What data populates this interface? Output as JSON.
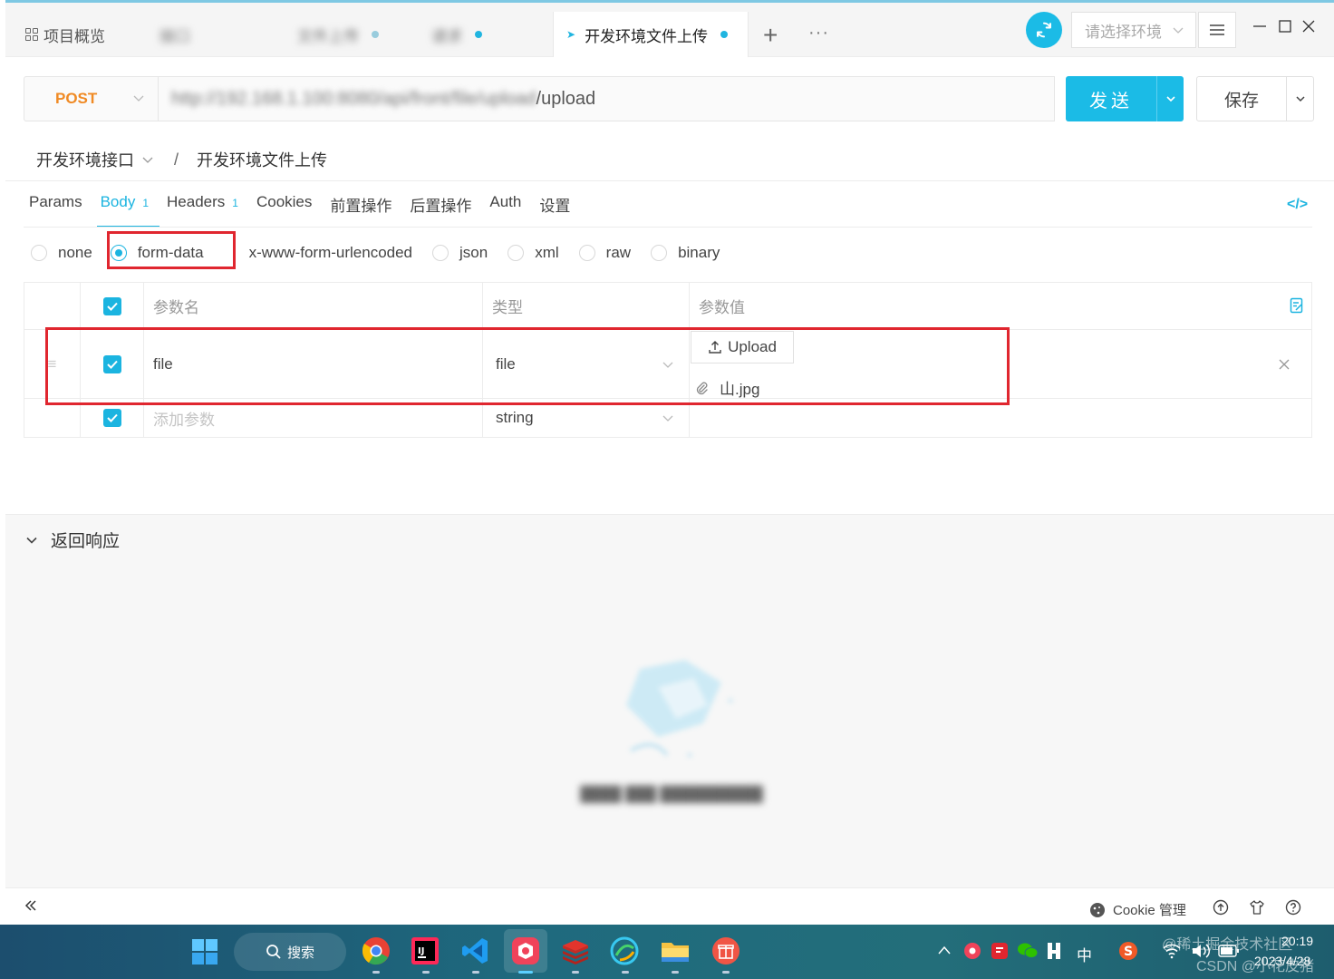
{
  "tabs": {
    "overview": "项目概览",
    "active_tab": "开发环境文件上传",
    "blurred": [
      "接口",
      "文件上传",
      "请求"
    ]
  },
  "toolbar": {
    "env_placeholder": "请选择环境",
    "new_tab": "+",
    "more": "···"
  },
  "request": {
    "method": "POST",
    "url_visible_suffix": "/upload",
    "url_blurred_prefix": "http://192.168.1.100:8080/api/front/file/upload",
    "send_label": "发送",
    "save_label": "保存"
  },
  "breadcrumb": {
    "folder": "开发环境接口",
    "separator": "/",
    "name": "开发环境文件上传"
  },
  "request_tabs": [
    {
      "label": "Params",
      "count": ""
    },
    {
      "label": "Body",
      "count": "1"
    },
    {
      "label": "Headers",
      "count": "1"
    },
    {
      "label": "Cookies",
      "count": ""
    },
    {
      "label": "前置操作",
      "count": ""
    },
    {
      "label": "后置操作",
      "count": ""
    },
    {
      "label": "Auth",
      "count": ""
    },
    {
      "label": "设置",
      "count": ""
    }
  ],
  "body_types": [
    "none",
    "form-data",
    "x-www-form-urlencoded",
    "json",
    "xml",
    "raw",
    "binary"
  ],
  "body_selected": "form-data",
  "table": {
    "headers": {
      "name": "参数名",
      "type": "类型",
      "value": "参数值"
    },
    "rows": [
      {
        "name": "file",
        "type": "file",
        "upload_label": "Upload",
        "filename": "山.jpg"
      }
    ],
    "new_row": {
      "name_placeholder": "添加参数",
      "type": "string"
    }
  },
  "response": {
    "title": "返回响应"
  },
  "statusbar": {
    "cookie": "Cookie 管理"
  },
  "taskbar": {
    "search": "搜索",
    "ime": "中",
    "time": "20:19",
    "date": "2023/4/28",
    "watermark1": "@稀土掘金技术社区",
    "watermark2": "CSDN @小花皮猪"
  },
  "colors": {
    "accent": "#1bb4e0",
    "method": "#f08a24",
    "highlight": "#e0262f"
  }
}
